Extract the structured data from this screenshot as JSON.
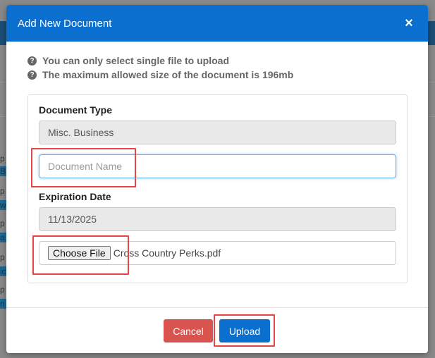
{
  "modal": {
    "title": "Add New Document",
    "close_icon": "×"
  },
  "notes": [
    {
      "icon": "question-circle-icon",
      "text": "You can only select single file to upload"
    },
    {
      "icon": "question-circle-icon",
      "text": "The maximum allowed size of the document is 196mb"
    }
  ],
  "form": {
    "document_type_label": "Document Type",
    "document_type_value": "Misc. Business",
    "document_name_placeholder": "Document Name",
    "document_name_value": "",
    "expiration_label": "Expiration Date",
    "expiration_value": "11/13/2025",
    "choose_file_label": "Choose File",
    "file_name": "Cross Country Perks.pdf"
  },
  "footer": {
    "cancel_label": "Cancel",
    "upload_label": "Upload"
  },
  "background_fragments": [
    "p",
    "B",
    "p",
    "w",
    "p",
    "a",
    "p",
    "ic",
    "p",
    "n"
  ],
  "colors": {
    "header": "#0a6fcf",
    "cancel": "#d9534f",
    "upload": "#0a6fcf",
    "highlight": "#e64545"
  }
}
